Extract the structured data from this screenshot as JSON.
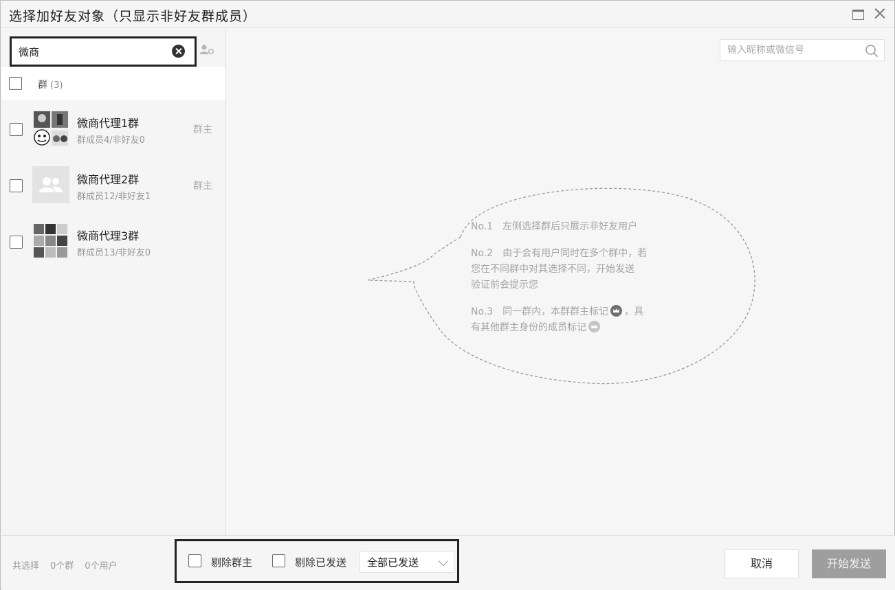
{
  "window": {
    "title": "选择加好友对象（只显示非好友群成员）"
  },
  "left": {
    "search_value": "微商",
    "group_header": {
      "label": "群",
      "count": "(3)"
    },
    "groups": [
      {
        "name": "微商代理1群",
        "sub": "群成员4/非好友0",
        "role": "群主",
        "avatar": "photo-grid-avatar"
      },
      {
        "name": "微商代理2群",
        "sub": "群成员12/非好友1",
        "role": "群主",
        "avatar": "default-group-avatar"
      },
      {
        "name": "微商代理3群",
        "sub": "群成员13/非好友0",
        "role": "",
        "avatar": "photo-grid-avatar"
      }
    ]
  },
  "main": {
    "nick_search_placeholder": "输入昵称或微信号",
    "tips": {
      "tip1": "No.1　左侧选择群后只展示非好友用户",
      "tip2_line1": "No.2　由于会有用户同时在多个群中，若",
      "tip2_line2": "您在不同群中对其选择不同，开始发送",
      "tip2_line3": "验证前会提示您",
      "tip3_part1": "No.3　同一群内，本群群主标记",
      "tip3_part2": "，具",
      "tip3_line2": "有其他群主身份的成员标记"
    }
  },
  "bottom": {
    "stats_prefix": "共选择",
    "stats_groups": "0个群",
    "stats_users": "0个用户",
    "opt_remove_owner": "剔除群主",
    "opt_remove_sent": "剔除已发送",
    "select_value": "全部已发送",
    "cancel_label": "取消",
    "send_label": "开始发送"
  },
  "colors": {
    "background": "#f5f5f5",
    "send_button": "#9e9e9e",
    "tip_text": "#a4a4a4",
    "highlight_border": "#222222"
  }
}
